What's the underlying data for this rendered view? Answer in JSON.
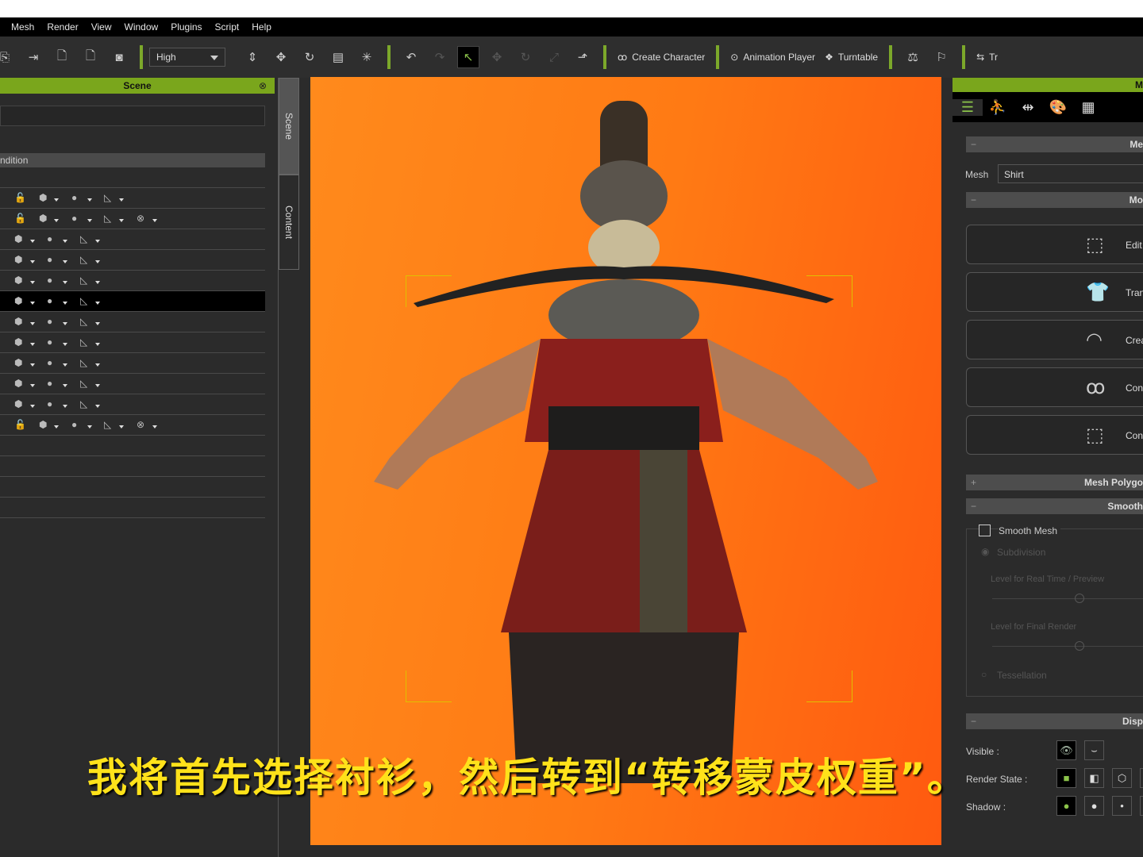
{
  "menu": [
    "Mesh",
    "Render",
    "View",
    "Window",
    "Plugins",
    "Script",
    "Help"
  ],
  "toolbar": {
    "quality": "High",
    "create_character": "Create Character",
    "animation_player": "Animation Player",
    "turntable": "Turntable",
    "tr": "Tr"
  },
  "scene_panel": {
    "title": "Scene",
    "column_header": "ndition",
    "tabs": [
      "Scene",
      "Content"
    ]
  },
  "right_panel": {
    "header": "M",
    "sections": {
      "mesh": "Me",
      "modify": "Mo",
      "mesh_polygon": "Mesh Polygo",
      "smooth": "Smooth",
      "display": "Disp"
    },
    "mesh_label": "Mesh",
    "mesh_value": "Shirt",
    "buttons": [
      "Edit",
      "Tran",
      "Crea",
      "Con",
      "Con"
    ],
    "smooth_mesh": "Smooth Mesh",
    "subdivision": "Subdivision",
    "level_realtime": "Level for Real Time / Preview",
    "level_final": "Level for Final Render",
    "tessellation": "Tessellation",
    "visible": "Visible :",
    "render_state": "Render State :",
    "shadow": "Shadow :"
  },
  "subtitle": "我将首先选择衬衫，然后转到“转移蒙皮权重”。"
}
